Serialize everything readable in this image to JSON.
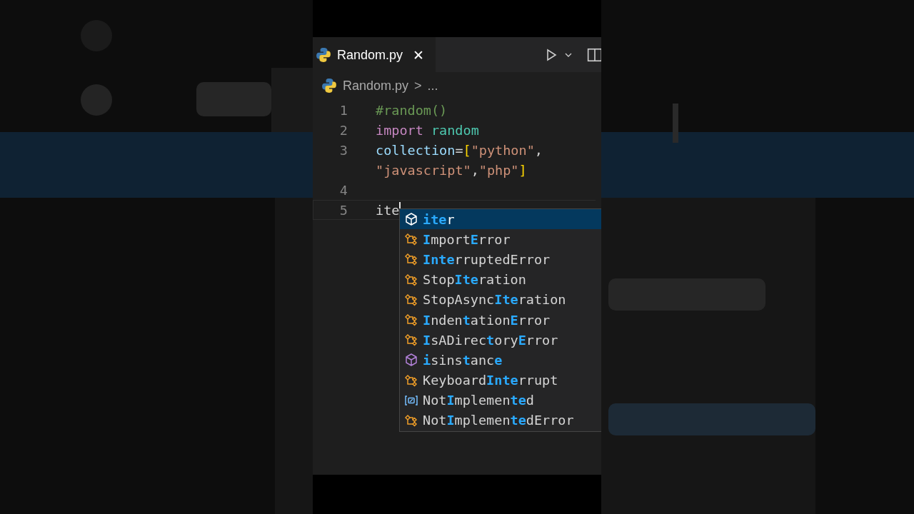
{
  "tab": {
    "title": "Random.py",
    "close": "✕",
    "selected": true
  },
  "breadcrumb": {
    "file": "Random.py",
    "separator": ">",
    "rest": "..."
  },
  "lines": [
    {
      "number": "1",
      "current": false,
      "tokens": [
        {
          "text": "#random()",
          "kind": "comment"
        }
      ]
    },
    {
      "number": "2",
      "current": false,
      "tokens": [
        {
          "text": "import",
          "kind": "keyword"
        },
        {
          "text": "random",
          "kind": "module"
        }
      ]
    },
    {
      "number": "3",
      "current": false,
      "tokens": [
        {
          "text": "collection",
          "kind": "variable"
        },
        {
          "text": "=",
          "kind": "plain"
        },
        {
          "text": "[",
          "kind": "bracket"
        },
        {
          "text": "\"python\"",
          "kind": "string"
        },
        {
          "text": ",",
          "kind": "plain"
        }
      ],
      "wrap_tokens": [
        {
          "text": "\"javascript\"",
          "kind": "string"
        },
        {
          "text": ",",
          "kind": "plain"
        },
        {
          "text": "\"php\"",
          "kind": "string"
        },
        {
          "text": "]",
          "kind": "bracket"
        }
      ]
    },
    {
      "number": "4",
      "current": false
    },
    {
      "number": "5",
      "current": true,
      "tokens": [
        {
          "text": "ite",
          "kind": "plain"
        }
      ]
    }
  ],
  "suggestions": [
    {
      "kind": "function",
      "selected": true,
      "label": "**ite**r"
    },
    {
      "kind": "class",
      "selected": false,
      "label": "**I**mport**E**rror"
    },
    {
      "kind": "class",
      "selected": false,
      "label": "**Inte**rruptedError"
    },
    {
      "kind": "class",
      "selected": false,
      "label": "Stop**Ite**ration"
    },
    {
      "kind": "class",
      "selected": false,
      "label": "StopAsync**Ite**ration"
    },
    {
      "kind": "class",
      "selected": false,
      "label": "**I**nden**t**ation**E**rror"
    },
    {
      "kind": "class",
      "selected": false,
      "label": "**I**sADirec**t**ory**E**rror"
    },
    {
      "kind": "method",
      "selected": false,
      "label": "**i**sins**t**anc**e**"
    },
    {
      "kind": "class",
      "selected": false,
      "label": "Keyboard**Inte**rrupt"
    },
    {
      "kind": "constant",
      "selected": false,
      "label": "Not**I**mplemen**te**d"
    },
    {
      "kind": "class",
      "selected": false,
      "label": "Not**I**mplemen**te**dError"
    }
  ]
}
